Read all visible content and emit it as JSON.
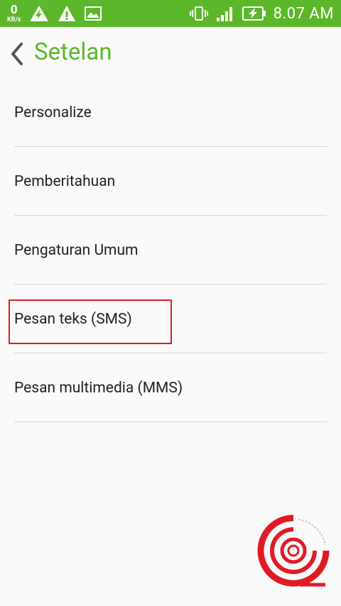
{
  "status_bar": {
    "speed_value": "0",
    "speed_unit": "KB/s",
    "time": "8.07 AM",
    "icons": [
      "data-warning-icon",
      "alert-icon",
      "image-icon",
      "vibrate-icon",
      "signal-icon",
      "battery-charging-icon"
    ]
  },
  "app_bar": {
    "back_icon": "chevron-left-icon",
    "title": "Setelan"
  },
  "settings_list": [
    {
      "label": "Personalize"
    },
    {
      "label": "Pemberitahuan"
    },
    {
      "label": "Pengaturan Umum"
    },
    {
      "label": "Pesan teks (SMS)"
    },
    {
      "label": "Pesan multimedia (MMS)"
    }
  ],
  "colors": {
    "accent": "#5cb82a",
    "highlight": "#e01b24",
    "background": "#fafafa"
  }
}
